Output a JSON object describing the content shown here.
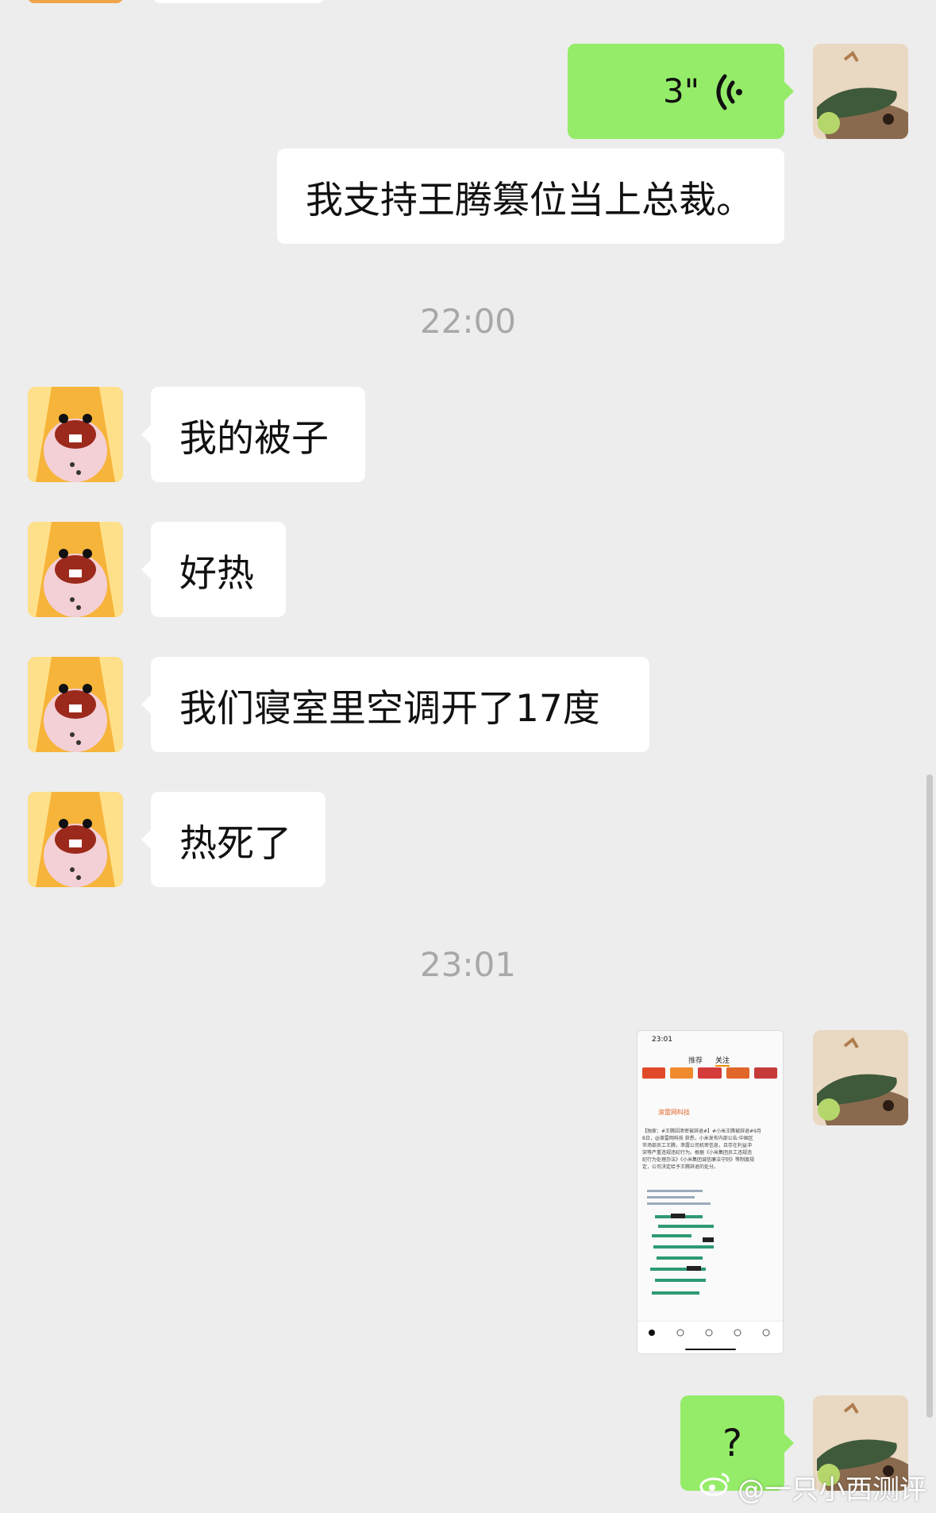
{
  "messages": {
    "voice": {
      "duration": "3\""
    },
    "outgoing_text_1": "我支持王腾篡位当上总裁。",
    "time_1": "22:00",
    "incoming": [
      "我的被子",
      "好热",
      "我们寝室里空调开了17度",
      "热死了"
    ],
    "time_2": "23:01",
    "outgoing_text_2": "?"
  },
  "screenshot_thumb": {
    "status_time": "23:01",
    "tabs": [
      "推荐",
      "关注"
    ],
    "poster": "滚雷网科技",
    "body_lines": [
      "【独家：#王腾因泄密被辞退#】#小米王腾被辞退#9月",
      "8日，@滚雷网科技 获悉，小米发布内部公告:中国区",
      "市场部员工王腾，泄露公司机密信息，且存在利益冲",
      "突等严重违规违纪行为。根据《小米集团员工违规违",
      "纪行为处理办法》《小米集团诚信廉洁守则》等制度规",
      "定，公司决定给予王腾辞退的处分。"
    ]
  },
  "watermark": "@一只小西测评",
  "colors": {
    "background": "#ededed",
    "outgoing_bubble": "#95ec69",
    "incoming_bubble": "#ffffff",
    "timestamp": "#a8a8a8"
  },
  "icons": {
    "voice": "voice-wave-icon",
    "weibo": "weibo-logo-icon"
  }
}
